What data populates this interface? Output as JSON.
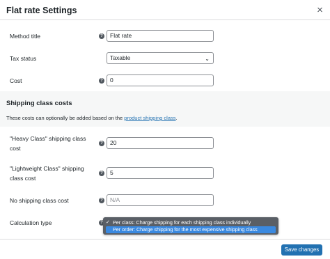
{
  "modal": {
    "title": "Flat rate Settings",
    "close_glyph": "×"
  },
  "fields": {
    "method_title": {
      "label": "Method title",
      "value": "Flat rate"
    },
    "tax_status": {
      "label": "Tax status",
      "value": "Taxable"
    },
    "cost": {
      "label": "Cost",
      "value": "0"
    }
  },
  "shipping_class_costs": {
    "heading": "Shipping class costs",
    "description_prefix": "These costs can optionally be added based on the ",
    "description_link": "product shipping class",
    "description_suffix": ".",
    "heavy": {
      "label_line1": "\"Heavy Class\" shipping class",
      "label_line2": "cost",
      "value": "20"
    },
    "lightweight": {
      "label_line1": "\"Lightweight Class\" shipping",
      "label_line2": "class cost",
      "value": "5"
    },
    "no_class": {
      "label": "No shipping class cost",
      "placeholder": "N/A"
    },
    "calculation": {
      "label": "Calculation type",
      "options": [
        {
          "check": "✓",
          "label": "Per class: Charge shipping for each shipping class individually",
          "selected": true
        },
        {
          "check": "",
          "label": "Per order: Charge shipping for the most expensive shipping class",
          "highlighted": true
        }
      ]
    }
  },
  "footer": {
    "save_label": "Save changes"
  },
  "help_glyph": "?",
  "chevron_glyph": "⌄",
  "colors": {
    "accent": "#2271b1",
    "highlight": "#3a89e0",
    "dropdown_bg": "#5a5f66"
  }
}
